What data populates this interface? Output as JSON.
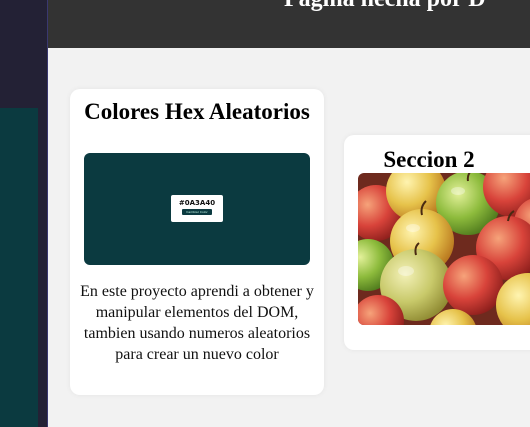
{
  "header": {
    "title": "Pagina hecha por D"
  },
  "cards": [
    {
      "title": "Colores Hex Aleatorios",
      "preview": {
        "hex": "#0A3A40",
        "button_label": "Cambiar Color",
        "bg_color": "#0b3a40"
      },
      "description": "En este proyecto aprendi a obtener y manipular elementos del DOM, tambien usando numeros aleatorios para crear un nuevo color"
    },
    {
      "title": "Seccion 2",
      "image": "apples-photo"
    }
  ],
  "colors": {
    "header_bg": "#333333",
    "page_bg": "#f2f2f2",
    "sidebar_bg": "#232135",
    "teal": "#0b3a40"
  }
}
